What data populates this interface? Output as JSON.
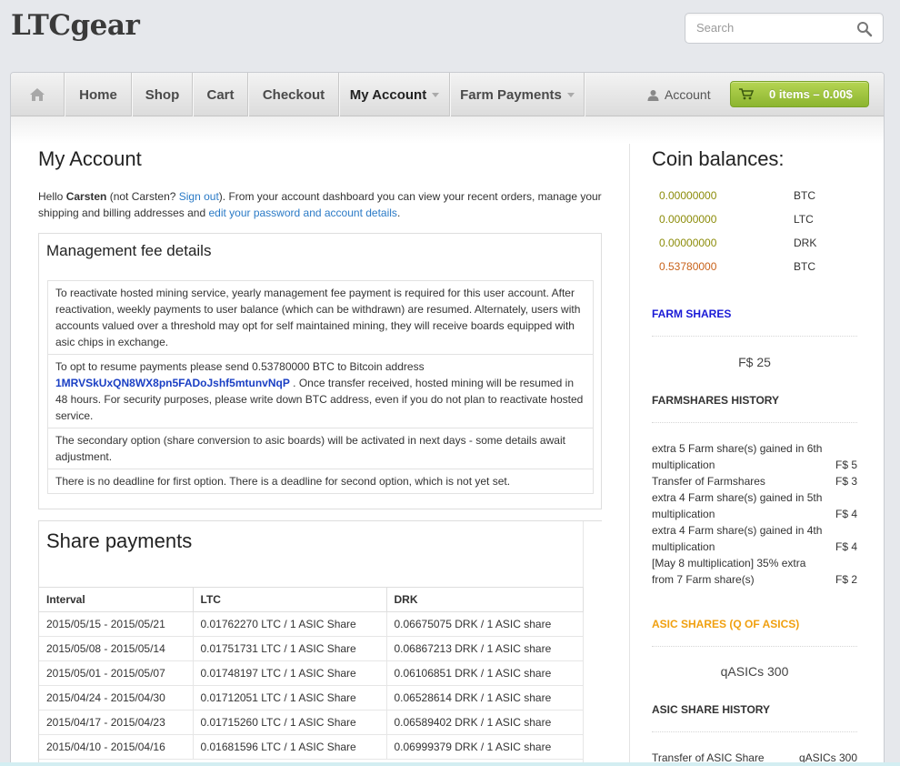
{
  "header": {
    "logo": "LTCgear",
    "search_placeholder": "Search"
  },
  "nav": {
    "items": [
      {
        "label": "Home"
      },
      {
        "label": "Shop"
      },
      {
        "label": "Cart"
      },
      {
        "label": "Checkout"
      },
      {
        "label": "My Account"
      },
      {
        "label": "Farm Payments"
      }
    ],
    "account_label": "Account",
    "cart_label": "0 items – 0.00$"
  },
  "main": {
    "title": "My Account",
    "hello": {
      "prefix": "Hello ",
      "user": "Carsten",
      "not_user": " (not Carsten? ",
      "sign_out": "Sign out",
      "middle": "). From your account dashboard you can view your recent orders, manage your shipping and billing addresses and ",
      "edit_link": "edit your password and account details",
      "suffix": "."
    },
    "management": {
      "title": "Management fee details",
      "p1": "To reactivate hosted mining service, yearly management fee payment is required for this user account. After reactivation, weekly payments to user balance (which can be withdrawn) are resumed. Alternately, users with accounts valued over a threshold may opt for self maintained mining, they will receive boards equipped with asic chips in exchange.",
      "p2_prefix": "To opt to resume payments please send 0.53780000 BTC to Bitcoin address",
      "p2_address": "1MRVSkUxQN8WX8pn5FADoJshf5mtunvNqP",
      "p2_suffix": " . Once transfer received, hosted mining will be resumed in 48 hours. For security purposes, please write down BTC address, even if you do not plan to reactivate hosted service.",
      "p3": "The secondary option (share conversion to asic boards) will be activated in next days - some details await adjustment.",
      "p4": "There is no deadline for first option. There is a deadline for second option, which is not yet set."
    },
    "share_payments": {
      "title": "Share payments",
      "columns": [
        "Interval",
        "LTC",
        "DRK"
      ],
      "rows": [
        [
          "2015/05/15 - 2015/05/21",
          "0.01762270 LTC / 1 ASIC Share",
          "0.06675075 DRK / 1 ASIC share"
        ],
        [
          "2015/05/08 - 2015/05/14",
          "0.01751731 LTC / 1 ASIC Share",
          "0.06867213 DRK / 1 ASIC share"
        ],
        [
          "2015/05/01 - 2015/05/07",
          "0.01748197 LTC / 1 ASIC Share",
          "0.06106851 DRK / 1 ASIC share"
        ],
        [
          "2015/04/24 - 2015/04/30",
          "0.01712051 LTC / 1 ASIC Share",
          "0.06528614 DRK / 1 ASIC share"
        ],
        [
          "2015/04/17 - 2015/04/23",
          "0.01715260 LTC / 1 ASIC Share",
          "0.06589402 DRK / 1 ASIC share"
        ],
        [
          "2015/04/10 - 2015/04/16",
          "0.01681596 LTC / 1 ASIC Share",
          "0.06999379 DRK / 1 ASIC share"
        ]
      ]
    }
  },
  "sidebar": {
    "title": "Coin balances:",
    "balances": [
      {
        "amount": "0.00000000",
        "currency": "BTC"
      },
      {
        "amount": "0.00000000",
        "currency": "LTC"
      },
      {
        "amount": "0.00000000",
        "currency": "DRK"
      },
      {
        "amount": "0.53780000",
        "currency": "BTC"
      }
    ],
    "farm_shares_heading": "FARM SHARES",
    "farm_shares_value": "F$ 25",
    "farmshares_history_heading": "FARMSHARES HISTORY",
    "farmshares_history": [
      {
        "text": "extra 5 Farm share(s) gained in 6th multiplication",
        "amount": "F$ 5"
      },
      {
        "text": "Transfer of Farmshares",
        "amount": "F$ 3"
      },
      {
        "text": "extra 4 Farm share(s) gained in 5th multiplication",
        "amount": "F$ 4"
      },
      {
        "text": "extra 4 Farm share(s) gained in 4th multiplication",
        "amount": "F$ 4"
      },
      {
        "text": "[May 8 multiplication] 35% extra from 7 Farm share(s)",
        "amount": "F$ 2"
      }
    ],
    "asic_shares_heading": "ASIC SHARES (Q OF ASICS)",
    "asic_shares_value": "qASICs 300",
    "asic_history_heading": "ASIC SHARE HISTORY",
    "asic_history": [
      {
        "text": "Transfer of ASIC Share",
        "amount": "qASICs 300"
      }
    ]
  },
  "colors": {
    "link": "#2a7ac6",
    "address": "#1a3fc4",
    "balance_zero": "#8c8c0a",
    "balance_nonzero": "#c8621a",
    "farm_heading": "#1a1ad6",
    "asic_heading": "#f0a010",
    "cart_button": "#9cc43c"
  }
}
